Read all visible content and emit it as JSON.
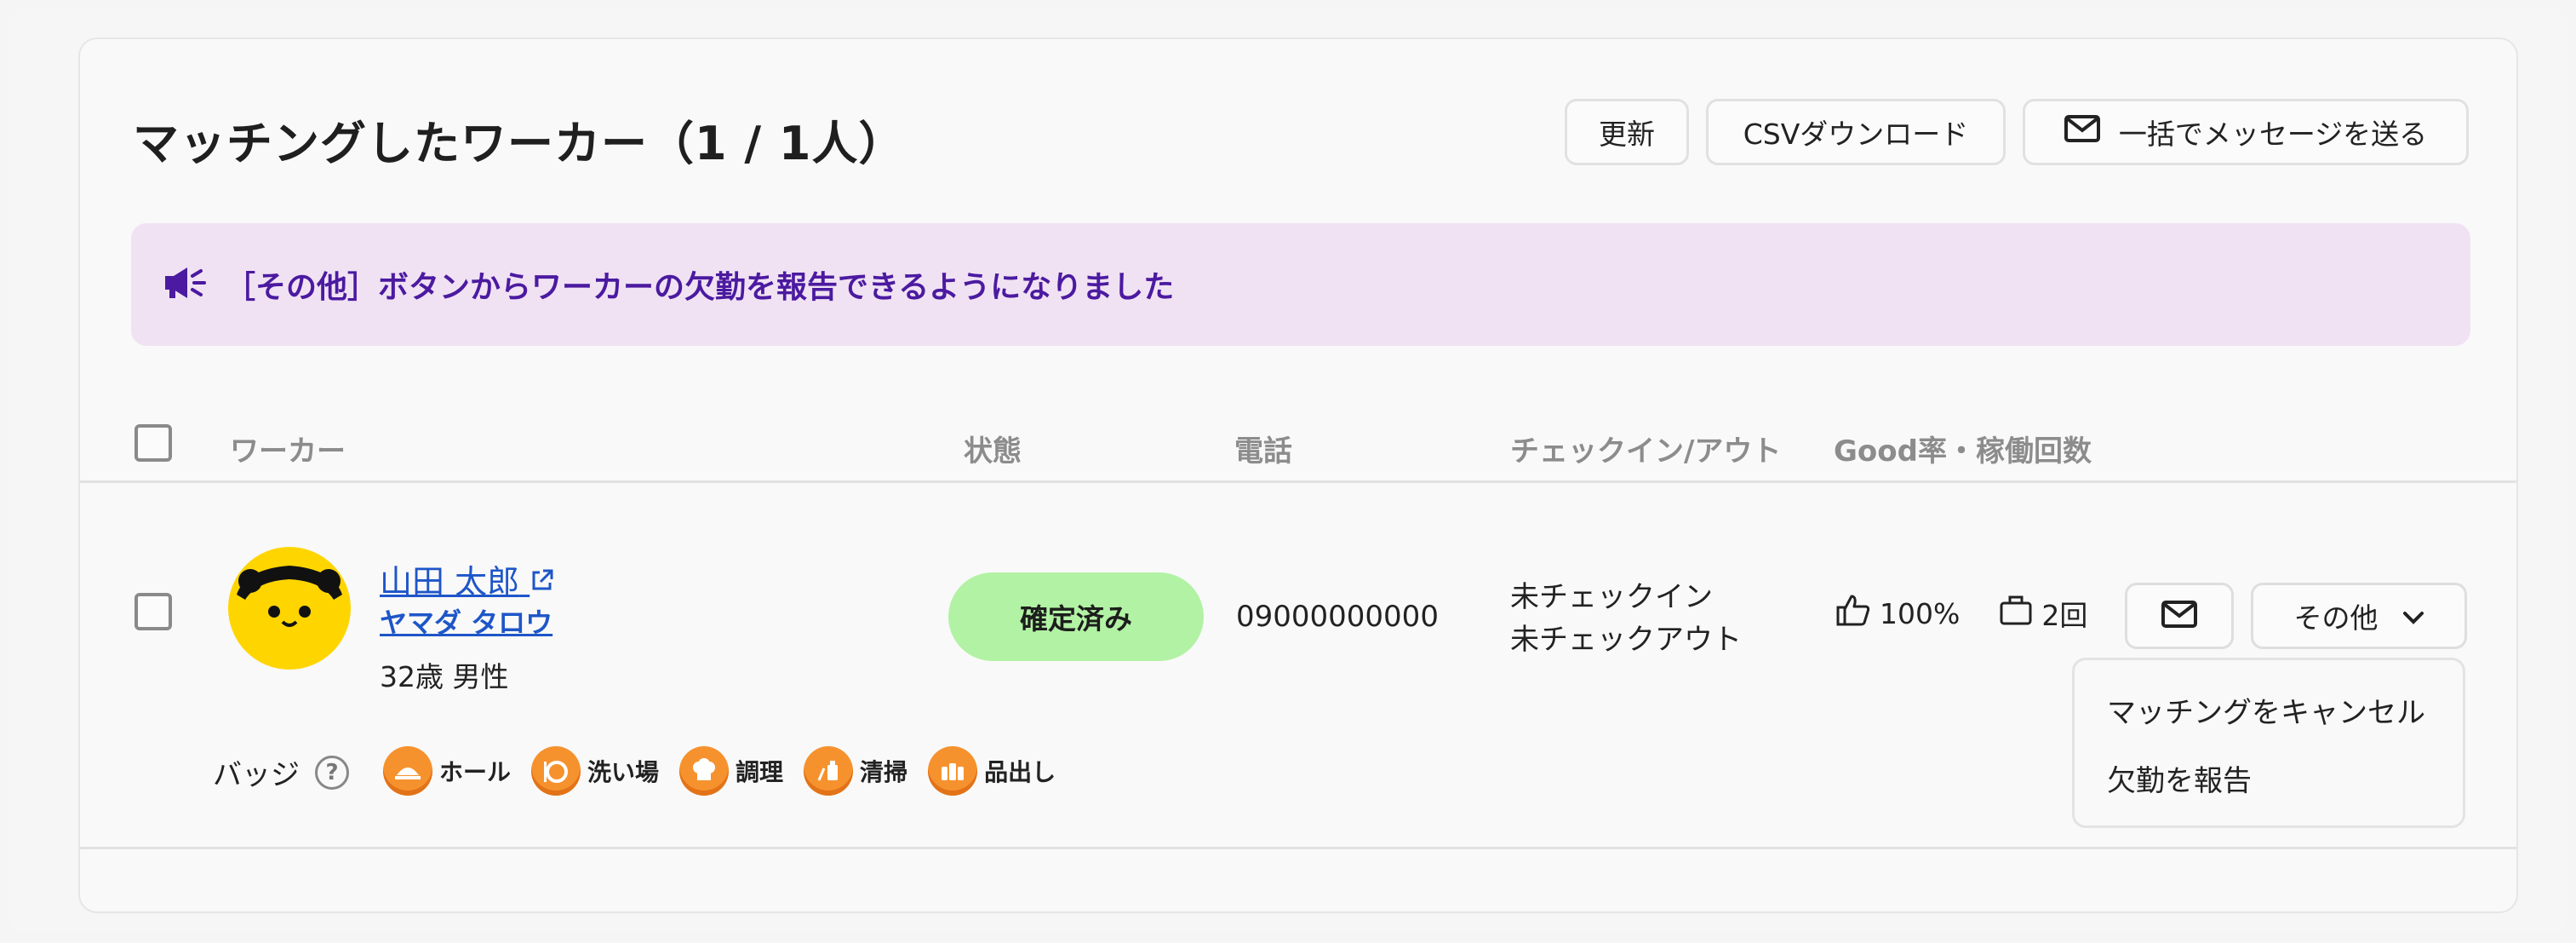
{
  "header": {
    "title": "マッチングしたワーカー（1 / 1人）",
    "update_label": "更新",
    "csv_label": "CSVダウンロード",
    "bulk_message_label": "一括でメッセージを送る"
  },
  "notice": {
    "text": "［その他］ボタンからワーカーの欠勤を報告できるようになりました",
    "icon": "megaphone-icon"
  },
  "table": {
    "columns": [
      "ワーカー",
      "状態",
      "電話",
      "チェックイン/アウト",
      "Good率・稼働回数"
    ],
    "rows": [
      {
        "name": "山田 太郎",
        "kana": "ヤマダ タロウ",
        "age_gender": "32歳 男性",
        "status": "確定済み",
        "phone": "09000000000",
        "checkin": "未チェックイン",
        "checkout": "未チェックアウト",
        "good_rate": "100%",
        "work_count": "2回",
        "other_label": "その他",
        "badge_label": "バッジ",
        "badges": [
          "ホール",
          "洗い場",
          "調理",
          "清掃",
          "品出し"
        ]
      }
    ]
  },
  "dropdown": {
    "items": [
      "マッチングをキャンセル",
      "欠勤を報告"
    ]
  },
  "colors": {
    "notice_bg": "#f0e2f3",
    "notice_text": "#4b1aa0",
    "status_bg": "#b2f2a4",
    "link": "#1e56c8",
    "badge": "#f6922e",
    "avatar": "#ffd500"
  }
}
